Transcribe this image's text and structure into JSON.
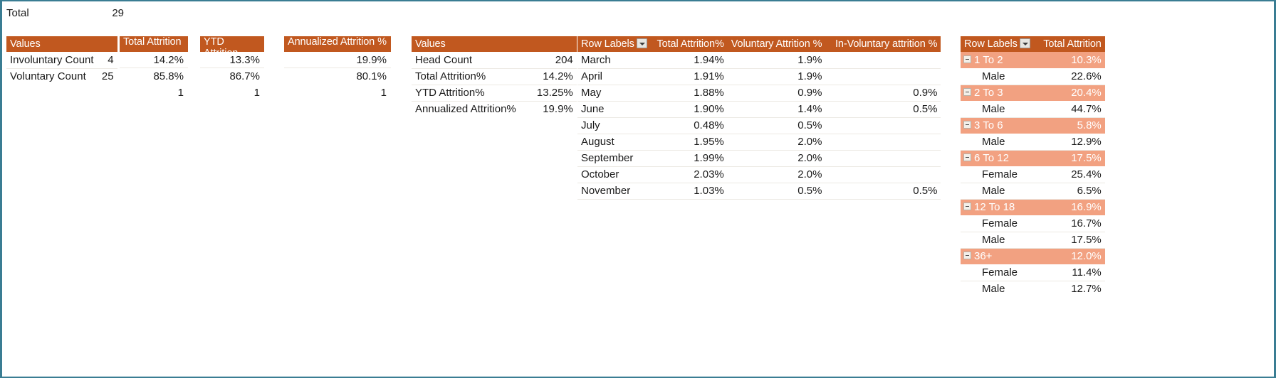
{
  "totals_strip": {
    "label": "Total",
    "value": "29"
  },
  "table_values_counts": {
    "header": "Values",
    "rows": [
      {
        "label": "Involuntary Count",
        "value": "4"
      },
      {
        "label": "Voluntary Count",
        "value": "25"
      },
      {
        "label": "",
        "value": ""
      }
    ]
  },
  "measure_blocks": [
    {
      "header": "Total Attrition",
      "values": [
        "14.2%",
        "85.8%",
        "1"
      ]
    },
    {
      "header": "YTD Attrition",
      "values": [
        "13.3%",
        "86.7%",
        "1"
      ]
    },
    {
      "header": "Annualized Attrition %",
      "values": [
        "19.9%",
        "80.1%",
        "1"
      ]
    }
  ],
  "table_values_metrics": {
    "header": "Values",
    "rows": [
      {
        "label": "Head Count",
        "value": "204"
      },
      {
        "label": "Total Attrition%",
        "value": "14.2%"
      },
      {
        "label": "YTD Attrition%",
        "value": "13.25%"
      },
      {
        "label": "Annualized Attrition%",
        "value": "19.9%"
      }
    ]
  },
  "pivot_months": {
    "headers": {
      "row_labels": "Row Labels",
      "total_attrition": "Total Attrition%",
      "voluntary_attrition": "Voluntary Attrition %",
      "involuntary_attrition": "In-Voluntary attrition %"
    },
    "rows": [
      {
        "label": "March",
        "total": "1.94%",
        "voluntary": "1.9%",
        "involuntary": ""
      },
      {
        "label": "April",
        "total": "1.91%",
        "voluntary": "1.9%",
        "involuntary": ""
      },
      {
        "label": "May",
        "total": "1.88%",
        "voluntary": "0.9%",
        "involuntary": "0.9%"
      },
      {
        "label": "June",
        "total": "1.90%",
        "voluntary": "1.4%",
        "involuntary": "0.5%"
      },
      {
        "label": "July",
        "total": "0.48%",
        "voluntary": "0.5%",
        "involuntary": ""
      },
      {
        "label": "August",
        "total": "1.95%",
        "voluntary": "2.0%",
        "involuntary": ""
      },
      {
        "label": "September",
        "total": "1.99%",
        "voluntary": "2.0%",
        "involuntary": ""
      },
      {
        "label": "October",
        "total": "2.03%",
        "voluntary": "2.0%",
        "involuntary": ""
      },
      {
        "label": "November",
        "total": "1.03%",
        "voluntary": "0.5%",
        "involuntary": "0.5%"
      }
    ]
  },
  "pivot_tenure": {
    "headers": {
      "row_labels": "Row Labels",
      "total_attrition": "Total Attrition"
    },
    "rows": [
      {
        "label": "1 To 2",
        "value": "10.3%",
        "type": "group"
      },
      {
        "label": "Male",
        "value": "22.6%",
        "type": "detail"
      },
      {
        "label": "2 To 3",
        "value": "20.4%",
        "type": "group"
      },
      {
        "label": "Male",
        "value": "44.7%",
        "type": "detail"
      },
      {
        "label": "3 To 6",
        "value": "5.8%",
        "type": "group"
      },
      {
        "label": "Male",
        "value": "12.9%",
        "type": "detail"
      },
      {
        "label": "6 To 12",
        "value": "17.5%",
        "type": "group"
      },
      {
        "label": "Female",
        "value": "25.4%",
        "type": "detail"
      },
      {
        "label": "Male",
        "value": "6.5%",
        "type": "detail"
      },
      {
        "label": "12 To 18",
        "value": "16.9%",
        "type": "group"
      },
      {
        "label": "Female",
        "value": "16.7%",
        "type": "detail"
      },
      {
        "label": "Male",
        "value": "17.5%",
        "type": "detail"
      },
      {
        "label": "36+",
        "value": "12.0%",
        "type": "group"
      },
      {
        "label": "Female",
        "value": "11.4%",
        "type": "detail"
      },
      {
        "label": "Male",
        "value": "12.7%",
        "type": "detail"
      }
    ]
  },
  "colors": {
    "header_fill": "#C1581F",
    "group_fill": "#F2A181",
    "border": "#3A7D93",
    "grid_line": "#ECE9E3",
    "text": "#1A1A1A"
  }
}
